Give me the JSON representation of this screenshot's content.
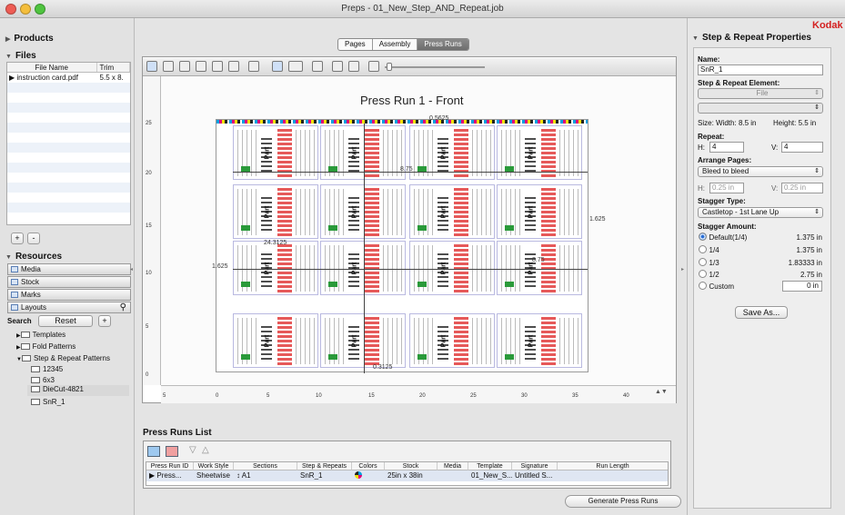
{
  "window": {
    "title": "Preps - 01_New_Step_AND_Repeat.job"
  },
  "brand": {
    "name": "Kodak",
    "color": "#d42020"
  },
  "left_panel": {
    "products_label": "Products",
    "files_label": "Files",
    "files_columns": [
      "File Name",
      "Trim"
    ],
    "files_rows": [
      {
        "name": "▶ instruction card.pdf",
        "trim": "5.5 x 8."
      }
    ],
    "add_label": "+",
    "remove_label": "-",
    "resources_label": "Resources",
    "resource_buttons": [
      "Media",
      "Stock",
      "Marks",
      "Layouts"
    ],
    "search_label": "Search",
    "reset_label": "Reset",
    "tree": [
      "Templates",
      "Fold Patterns",
      "Step & Repeat Patterns",
      "12345",
      "6x3",
      "DieCut-4821",
      "SnR_1"
    ]
  },
  "center": {
    "tabs": [
      "Pages",
      "Assembly",
      "Press Runs"
    ],
    "active_tab": "Press Runs",
    "sheet_title": "Press Run 1 - Front",
    "vruler_ticks": [
      "25",
      "20",
      "15",
      "10",
      "5",
      "0"
    ],
    "hruler_ticks": [
      "5",
      "0",
      "5",
      "10",
      "15",
      "20",
      "25",
      "30",
      "35",
      "40"
    ],
    "cell_text": "Part",
    "dims": {
      "top": "0.5625",
      "right": "1.625",
      "left": "1.625",
      "middle": "24.3125",
      "width": "8.75",
      "bottom": "0.3125",
      "inner": "8.75"
    },
    "press_runs_list_label": "Press Runs List",
    "pr_columns": [
      "Press Run ID",
      "Work Style",
      "Sections",
      "Step & Repeats",
      "Colors",
      "Stock",
      "Media",
      "Template",
      "Signature",
      "Run Length"
    ],
    "pr_rows": [
      {
        "id": "▶ Press...",
        "work_style": "Sheetwise",
        "sections": "↕ A1",
        "snr": "SnR_1",
        "colors": "",
        "stock": "25in x 38in",
        "media": "",
        "template": "01_New_S...",
        "signature": "Untitled S...",
        "run_length": ""
      }
    ],
    "generate_label": "Generate Press Runs"
  },
  "right_panel": {
    "title": "Step & Repeat Properties",
    "name_label": "Name:",
    "name_value": "SnR_1",
    "element_label": "Step & Repeat Element:",
    "element_value": "File",
    "size_label": "Size:",
    "width_label": "Width:",
    "width_value": "8.5 in",
    "height_label": "Height:",
    "height_value": "5.5 in",
    "repeat_label": "Repeat:",
    "h_label": "H:",
    "h_value": "4",
    "v_label": "V:",
    "v_value": "4",
    "arrange_label": "Arrange Pages:",
    "arrange_value": "Bleed to bleed",
    "gap_h_label": "H:",
    "gap_h_value": "0.25 in",
    "gap_v_label": "V:",
    "gap_v_value": "0.25 in",
    "stagger_type_label": "Stagger Type:",
    "stagger_type_value": "Castletop - 1st Lane Up",
    "stagger_amount_label": "Stagger Amount:",
    "stagger_options": [
      {
        "label": "Default(1/4)",
        "value": "1.375 in",
        "selected": true
      },
      {
        "label": "1/4",
        "value": "1.375 in",
        "selected": false
      },
      {
        "label": "1/3",
        "value": "1.83333 in",
        "selected": false
      },
      {
        "label": "1/2",
        "value": "2.75 in",
        "selected": false
      },
      {
        "label": "Custom",
        "value": "0 in",
        "selected": false
      }
    ],
    "save_as_label": "Save As..."
  }
}
